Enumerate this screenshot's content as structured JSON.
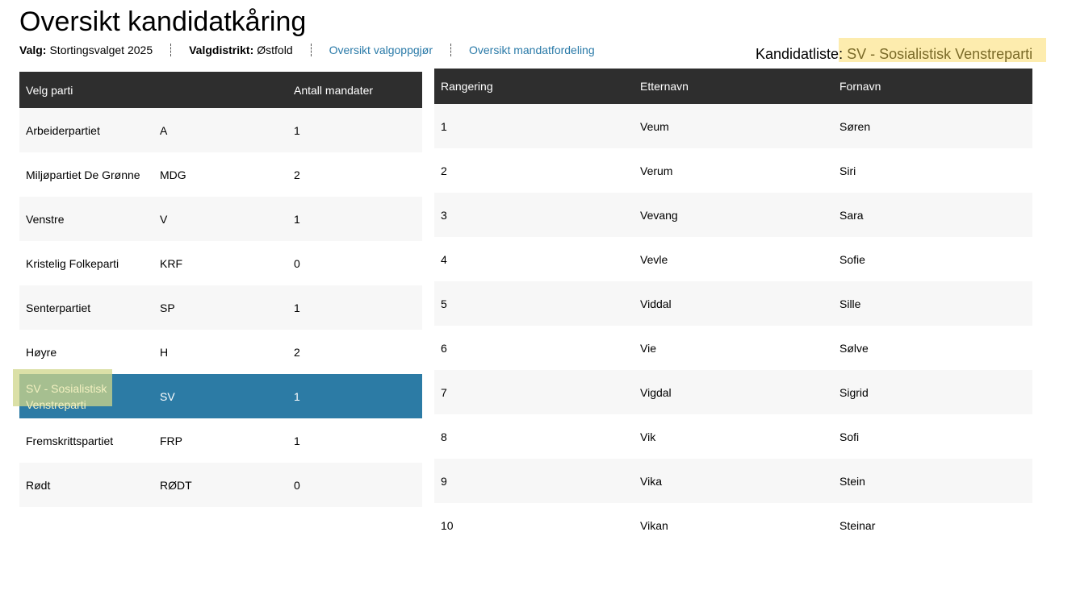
{
  "page": {
    "title": "Oversikt kandidatkåring"
  },
  "meta": {
    "valg_label": "Valg:",
    "valg_value": "Stortingsvalget 2025",
    "distrikt_label": "Valgdistrikt:",
    "distrikt_value": "Østfold",
    "link_valgoppgjor": "Oversikt valgoppgjør",
    "link_mandatfordeling": "Oversikt mandatfordeling"
  },
  "kandidatliste": {
    "prefix": "Kandidatliste:",
    "party": "SV - Sosialistisk Venstreparti"
  },
  "party_table": {
    "headers": [
      "Velg parti",
      "Antall mandater"
    ],
    "selected_index": 6,
    "rows": [
      {
        "name": "Arbeiderpartiet",
        "code": "A",
        "mandates": "1"
      },
      {
        "name": "Miljøpartiet De Grønne",
        "code": "MDG",
        "mandates": "2"
      },
      {
        "name": "Venstre",
        "code": "V",
        "mandates": "1"
      },
      {
        "name": "Kristelig Folkeparti",
        "code": "KRF",
        "mandates": "0"
      },
      {
        "name": "Senterpartiet",
        "code": "SP",
        "mandates": "1"
      },
      {
        "name": "Høyre",
        "code": "H",
        "mandates": "2"
      },
      {
        "name": "SV - Sosialistisk Venstreparti",
        "name_line1": "SV - Sosialistisk",
        "name_line2": "Venstreparti",
        "code": "SV",
        "mandates": "1"
      },
      {
        "name": "Fremskrittspartiet",
        "code": "FRP",
        "mandates": "1"
      },
      {
        "name": "Rødt",
        "code": "RØDT",
        "mandates": "0"
      }
    ]
  },
  "candidate_table": {
    "headers": [
      "Rangering",
      "Etternavn",
      "Fornavn"
    ],
    "rows": [
      {
        "rank": "1",
        "last": "Veum",
        "first": "Søren"
      },
      {
        "rank": "2",
        "last": "Verum",
        "first": "Siri"
      },
      {
        "rank": "3",
        "last": "Vevang",
        "first": "Sara"
      },
      {
        "rank": "4",
        "last": "Vevle",
        "first": "Sofie"
      },
      {
        "rank": "5",
        "last": "Viddal",
        "first": "Sille"
      },
      {
        "rank": "6",
        "last": "Vie",
        "first": "Sølve"
      },
      {
        "rank": "7",
        "last": "Vigdal",
        "first": "Sigrid"
      },
      {
        "rank": "8",
        "last": "Vik",
        "first": "Sofi"
      },
      {
        "rank": "9",
        "last": "Vika",
        "first": "Stein"
      },
      {
        "rank": "10",
        "last": "Vikan",
        "first": "Steinar"
      }
    ]
  },
  "colors": {
    "header_bg": "#2e2e2e",
    "selected_row_bg": "#2c7ba5",
    "link": "#2a7aa8",
    "highlight": "#fde9a0"
  }
}
